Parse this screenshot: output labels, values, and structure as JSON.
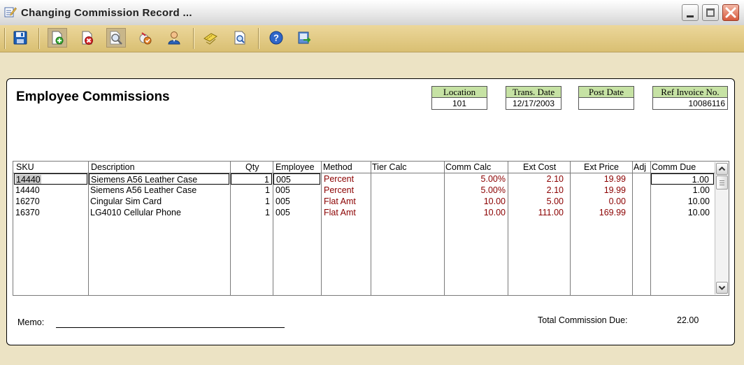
{
  "window": {
    "title": "Changing Commission Record ..."
  },
  "heading": "Employee Commissions",
  "header_fields": [
    {
      "label": "Location",
      "value": "101"
    },
    {
      "label": "Trans. Date",
      "value": "12/17/2003"
    },
    {
      "label": "Post Date",
      "value": ""
    },
    {
      "label": "Ref Invoice No.",
      "value": "10086116"
    }
  ],
  "grid": {
    "columns": [
      "SKU",
      "Description",
      "Qty",
      "Employee",
      "Method",
      "Tier Calc",
      "Comm Calc",
      "Ext Cost",
      "Ext Price",
      "Adj",
      "Comm Due"
    ],
    "rows": [
      {
        "sku": "14440",
        "description": "Siemens A56 Leather Case",
        "qty": "1",
        "employee": "005",
        "method": "Percent",
        "tier_calc": "",
        "comm_calc": "5.00%",
        "ext_cost": "2.10",
        "ext_price": "19.99",
        "adj": "",
        "comm_due": "1.00"
      },
      {
        "sku": "14440",
        "description": "Siemens A56 Leather Case",
        "qty": "1",
        "employee": "005",
        "method": "Percent",
        "tier_calc": "",
        "comm_calc": "5.00%",
        "ext_cost": "2.10",
        "ext_price": "19.99",
        "adj": "",
        "comm_due": "1.00"
      },
      {
        "sku": "16270",
        "description": "Cingular Sim Card",
        "qty": "1",
        "employee": "005",
        "method": "Flat Amt",
        "tier_calc": "",
        "comm_calc": "10.00",
        "ext_cost": "5.00",
        "ext_price": "0.00",
        "adj": "",
        "comm_due": "10.00"
      },
      {
        "sku": "16370",
        "description": "LG4010 Cellular Phone",
        "qty": "1",
        "employee": "005",
        "method": "Flat Amt",
        "tier_calc": "",
        "comm_calc": "10.00",
        "ext_cost": "111.00",
        "ext_price": "169.99",
        "adj": "",
        "comm_due": "10.00"
      }
    ]
  },
  "footer": {
    "memo_label": "Memo:",
    "memo_value": "",
    "total_label": "Total Commission Due:",
    "total_value": "22.00"
  },
  "toolbar_icons": [
    "save-icon",
    "new-record-icon",
    "delete-icon",
    "find-icon",
    "tools-icon",
    "employee-icon",
    "tickets-icon",
    "preview-icon",
    "help-icon",
    "exit-icon"
  ],
  "colors": {
    "label_green": "#c6e2a4",
    "toolbar_gold": "#d9bf72",
    "method_red": "#8b0000",
    "background": "#ece3c4"
  }
}
